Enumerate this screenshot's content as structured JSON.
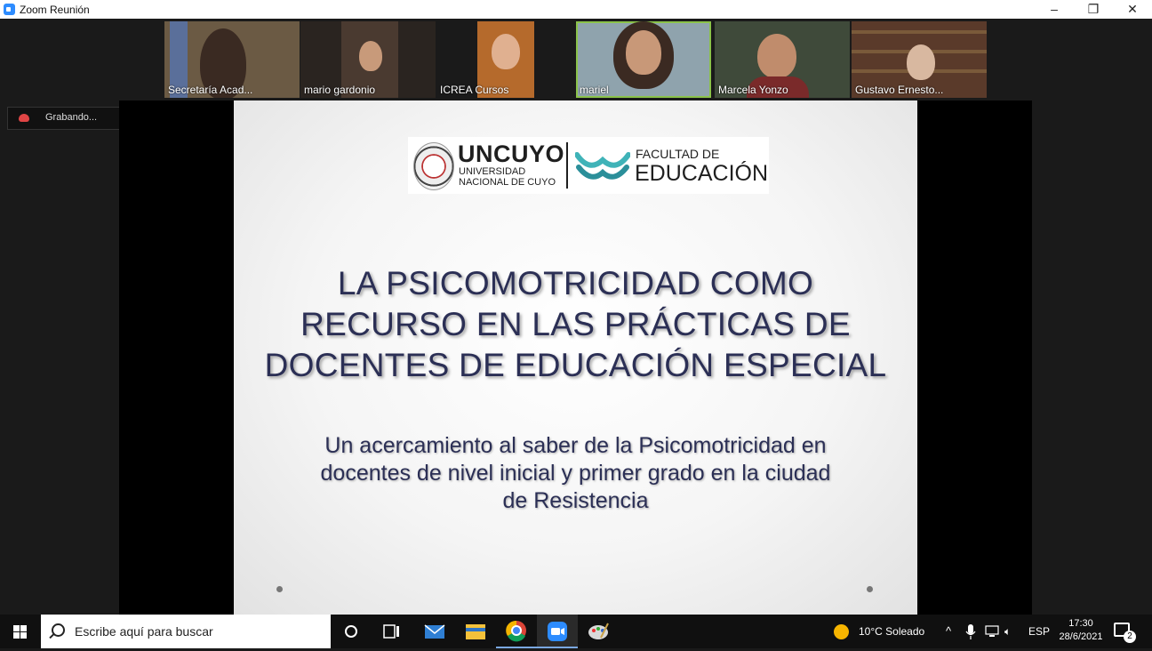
{
  "window": {
    "title": "Zoom Reunión",
    "minimize": "–",
    "maximize": "❐",
    "close": "✕"
  },
  "participants": [
    {
      "name": "Secretaría Acad...",
      "bg": "#6b5a44"
    },
    {
      "name": "mario gardonio",
      "bg": "#2a2420"
    },
    {
      "name": "ICREA Cursos",
      "bg": "#b56a2c"
    },
    {
      "name": "mariel",
      "bg": "#8fa3ad"
    },
    {
      "name": "Marcela Yonzo",
      "bg": "#3f4a3a"
    },
    {
      "name": "Gustavo Ernesto...",
      "bg": "#5a3a2a"
    }
  ],
  "recording": {
    "label": "Grabando..."
  },
  "slide": {
    "logo_main": "UNCUYO",
    "logo_sub_1": "UNIVERSIDAD",
    "logo_sub_2": "NACIONAL DE CUYO",
    "faculty_1": "FACULTAD DE",
    "faculty_2": "EDUCACIÓN",
    "title_lines": [
      "LA PSICOMOTRICIDAD COMO",
      "RECURSO EN LAS PRÁCTICAS DE",
      "DOCENTES DE EDUCACIÓN ESPECIAL"
    ],
    "subtitle_lines": [
      "Un acercamiento al saber de la Psicomotricidad en",
      "docentes de nivel inicial y primer grado en la ciudad",
      "de Resistencia"
    ]
  },
  "taskbar": {
    "search_placeholder": "Escribe aquí para buscar",
    "weather": "10°C  Soleado",
    "language": "ESP",
    "time": "17:30",
    "date": "28/6/2021",
    "notification_count": "2"
  },
  "colors": {
    "accent_zoom": "#2d8cff",
    "slide_text": "#2b2f55",
    "active_speaker": "#8bc34a"
  }
}
